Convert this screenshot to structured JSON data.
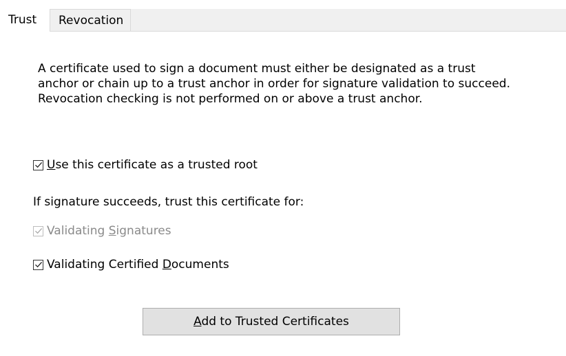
{
  "tabs": {
    "trust": "Trust",
    "revocation": "Revocation"
  },
  "description": {
    "line1": "A certificate used to sign a document must either be designated as a trust",
    "line2": "anchor or chain up to a trust anchor in order for signature validation to succeed.",
    "line3": "Revocation checking is not performed on or above a trust anchor."
  },
  "trusted_root": {
    "mnemonic": "U",
    "rest": "se this certificate as a trusted root",
    "checked": true
  },
  "trust_for_label": "If signature succeeds, trust this certificate for:",
  "validating_signatures": {
    "prefix": "Validating ",
    "mnemonic": "S",
    "rest": "ignatures",
    "checked": true,
    "enabled": false
  },
  "validating_certified": {
    "prefix": "Validating Certified ",
    "mnemonic": "D",
    "rest": "ocuments",
    "checked": true,
    "enabled": true
  },
  "add_button": {
    "mnemonic": "A",
    "rest": "dd to Trusted Certificates"
  },
  "colors": {
    "tab_inactive_bg": "#f0f0f0",
    "disabled_text": "#8a8a8a",
    "button_bg": "#e1e1e1",
    "button_border": "#adadad"
  }
}
